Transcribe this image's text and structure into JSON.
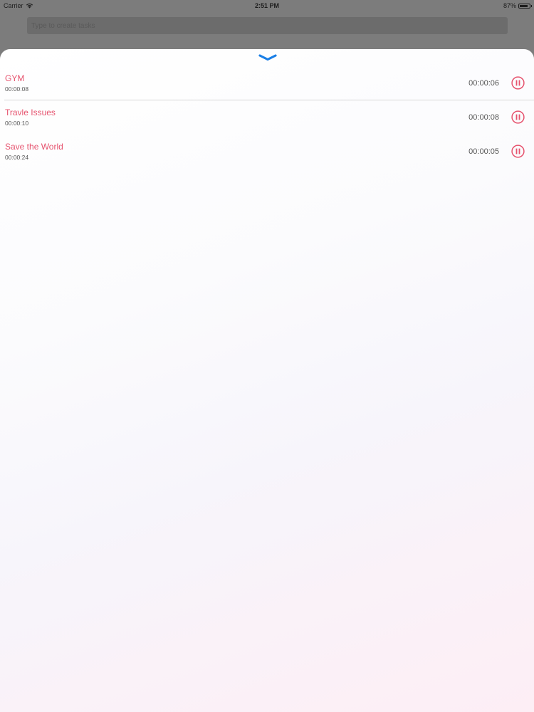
{
  "status_bar": {
    "carrier": "Carrier",
    "time": "2:51 PM",
    "battery_text": "87%",
    "battery_level": 0.87
  },
  "search": {
    "placeholder": "Type to create tasks"
  },
  "sheet": {
    "handle_icon": "chevron-down-icon"
  },
  "tasks": [
    {
      "title": "GYM",
      "subtitle": "00:00:08",
      "timer": "00:00:06",
      "action_icon": "pause-icon"
    },
    {
      "title": "Travle Issues",
      "subtitle": "00:00:10",
      "timer": "00:00:08",
      "action_icon": "pause-icon"
    },
    {
      "title": "Save the World",
      "subtitle": "00:00:24",
      "timer": "00:00:05",
      "action_icon": "pause-icon"
    }
  ],
  "colors": {
    "accent": "#e6536e",
    "chevron": "#1a7fe6",
    "dimmed_background": "#7c7c7c"
  }
}
